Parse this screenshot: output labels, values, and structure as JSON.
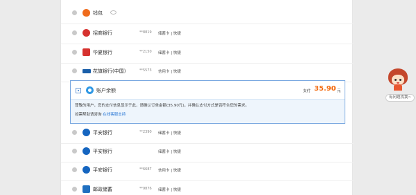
{
  "payment_options": [
    {
      "name": "钱包",
      "card": "",
      "type": "",
      "icon": "flame-icon",
      "color": "#ef6b1c",
      "hidden_eye": true
    },
    {
      "name": "招商银行",
      "card": "**8819",
      "type": "储蓄卡 | 快捷",
      "icon": "bank-logo-icon",
      "color": "#d6322f"
    },
    {
      "name": "华夏银行",
      "card": "**2150",
      "type": "储蓄卡 | 快捷",
      "icon": "bank-logo-icon",
      "color": "#d6322f"
    },
    {
      "name": "花旗银行(中国)",
      "card": "**5573",
      "type": "信用卡 | 快捷",
      "icon": "citi-logo-icon",
      "color": "#1a5ea8"
    }
  ],
  "selected_option": {
    "name": "账户余额",
    "amount_label": "支付",
    "amount": "35.90",
    "amount_unit": "元",
    "notice_line1": "尊敬的用户，您的支付信息显示于此，请确认订单金额(35.90元)，并确认支付方式是否符合您的需求。",
    "notice_line2_prefix": "如需帮助请咨询",
    "notice_link": "在线客服支持"
  },
  "more_options": [
    {
      "name": "平安银行",
      "card": "**2390",
      "type": "储蓄卡 | 快捷",
      "color": "#1565c0"
    },
    {
      "name": "平安银行",
      "card": "",
      "type": "储蓄卡 | 快捷",
      "color": "#1565c0"
    },
    {
      "name": "平安银行",
      "card": "**6687",
      "type": "信用卡 | 快捷",
      "color": "#1565c0"
    },
    {
      "name": "邮政储蓄",
      "card": "**9876",
      "type": "储蓄卡 | 快捷",
      "color": "#1f6fc0"
    }
  ],
  "help": {
    "label": "有问题找我~"
  }
}
